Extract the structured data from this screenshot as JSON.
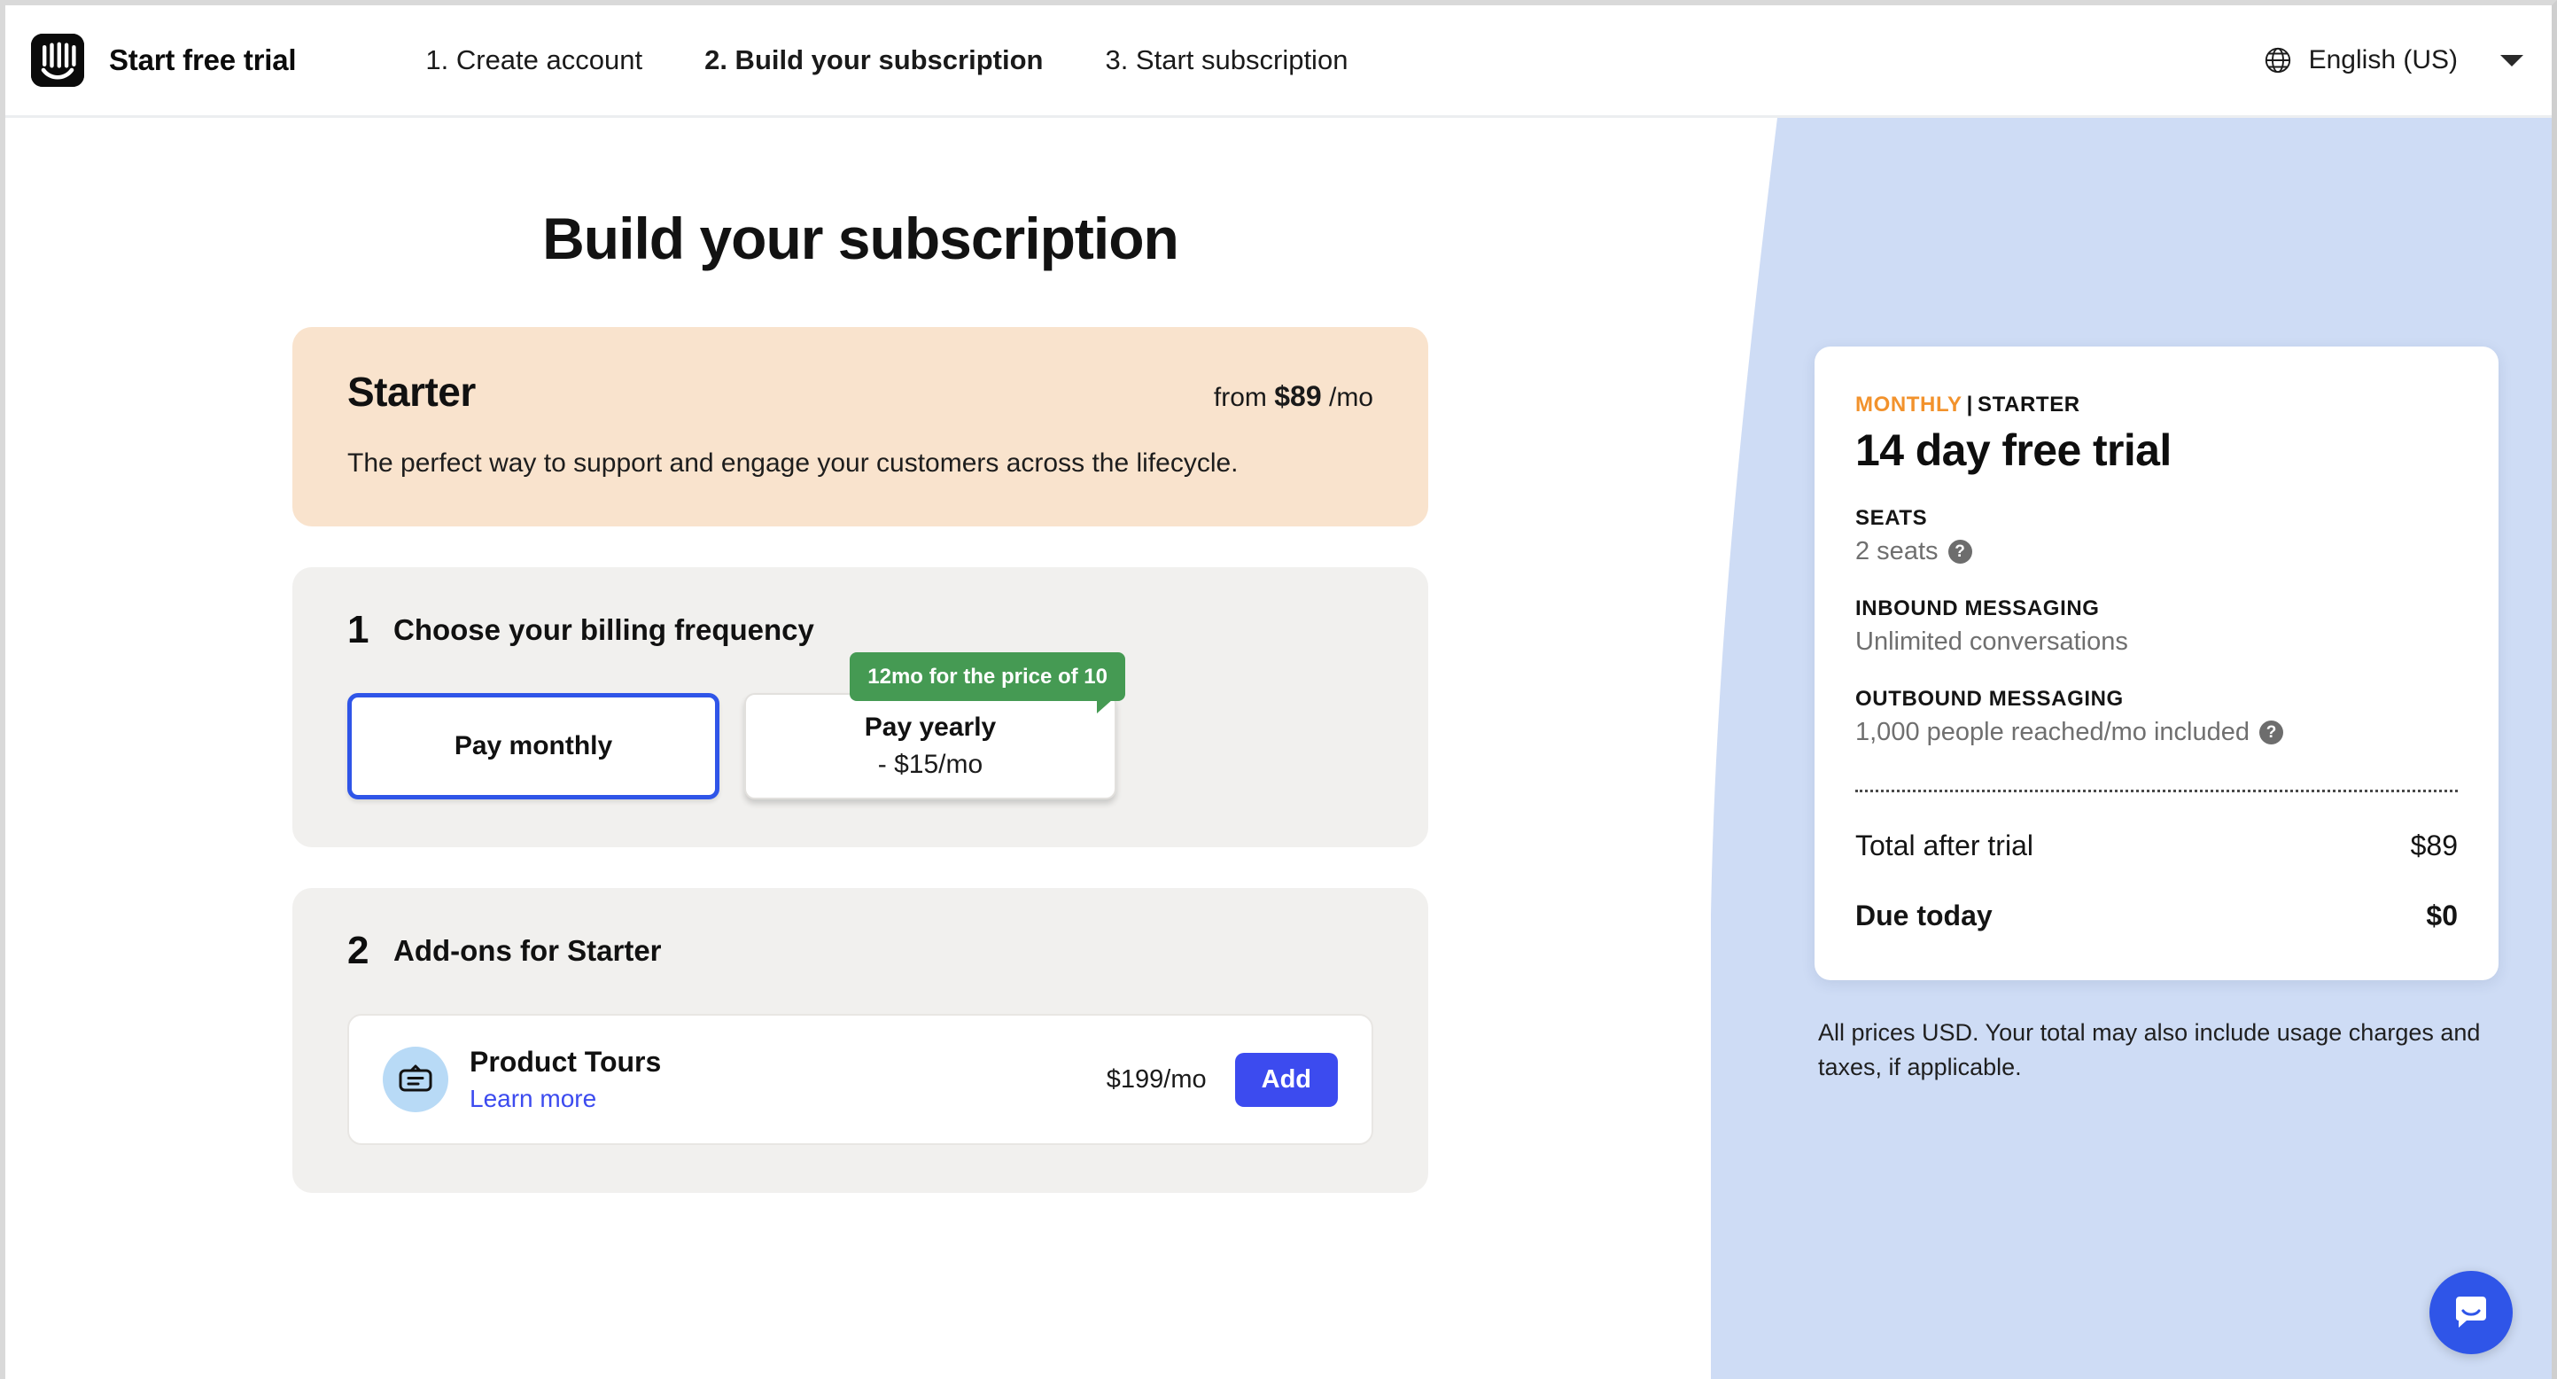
{
  "header": {
    "logo_icon": "intercom-logo-icon",
    "brand_title": "Start free trial",
    "steps": [
      {
        "label": "1. Create account",
        "active": false
      },
      {
        "label": "2. Build your subscription",
        "active": true
      },
      {
        "label": "3. Start subscription",
        "active": false
      }
    ],
    "language": {
      "icon": "globe-icon",
      "label": "English (US)",
      "caret_icon": "chevron-down-icon"
    }
  },
  "main": {
    "page_title": "Build your subscription",
    "plan": {
      "name": "Starter",
      "price_prefix": "from",
      "price_amount": "$89",
      "price_period": "/mo",
      "description": "The perfect way to support and engage your customers across the lifecycle."
    },
    "billing_section": {
      "number": "1",
      "title": "Choose your billing frequency",
      "options": [
        {
          "label": "Pay monthly",
          "sublabel": "",
          "selected": true
        },
        {
          "label": "Pay yearly",
          "sublabel": "- $15/mo",
          "selected": false
        }
      ],
      "promo_badge": "12mo for the price of 10"
    },
    "addons_section": {
      "number": "2",
      "title": "Add-ons for Starter",
      "items": [
        {
          "icon": "product-tours-icon",
          "name": "Product Tours",
          "link_label": "Learn more",
          "price": "$199/mo",
          "button_label": "Add"
        }
      ]
    }
  },
  "summary": {
    "cycle": "MONTHLY",
    "separator": "|",
    "tier": "STARTER",
    "headline": "14 day free trial",
    "groups": [
      {
        "label": "SEATS",
        "value": "2 seats",
        "has_help": true
      },
      {
        "label": "INBOUND MESSAGING",
        "value": "Unlimited conversations",
        "has_help": false
      },
      {
        "label": "OUTBOUND MESSAGING",
        "value": "1,000 people reached/mo included",
        "has_help": true
      }
    ],
    "totals": [
      {
        "label": "Total after trial",
        "value": "$89",
        "bold": false
      },
      {
        "label": "Due today",
        "value": "$0",
        "bold": true
      }
    ],
    "disclaimer": "All prices USD. Your total may also include usage charges and taxes, if applicable."
  },
  "messenger": {
    "icon": "intercom-messenger-icon"
  },
  "colors": {
    "accent_blue": "#3c4bef",
    "selected_border": "#2f55e8",
    "plan_banner_bg": "#f9e3cd",
    "section_bg": "#f1f0ee",
    "promo_green": "#459a53",
    "panel_blue": "#cedcf5",
    "eyebrow_orange": "#f2922c",
    "addon_icon_bg": "#b8daf6",
    "muted_text": "#6f6f6f"
  }
}
